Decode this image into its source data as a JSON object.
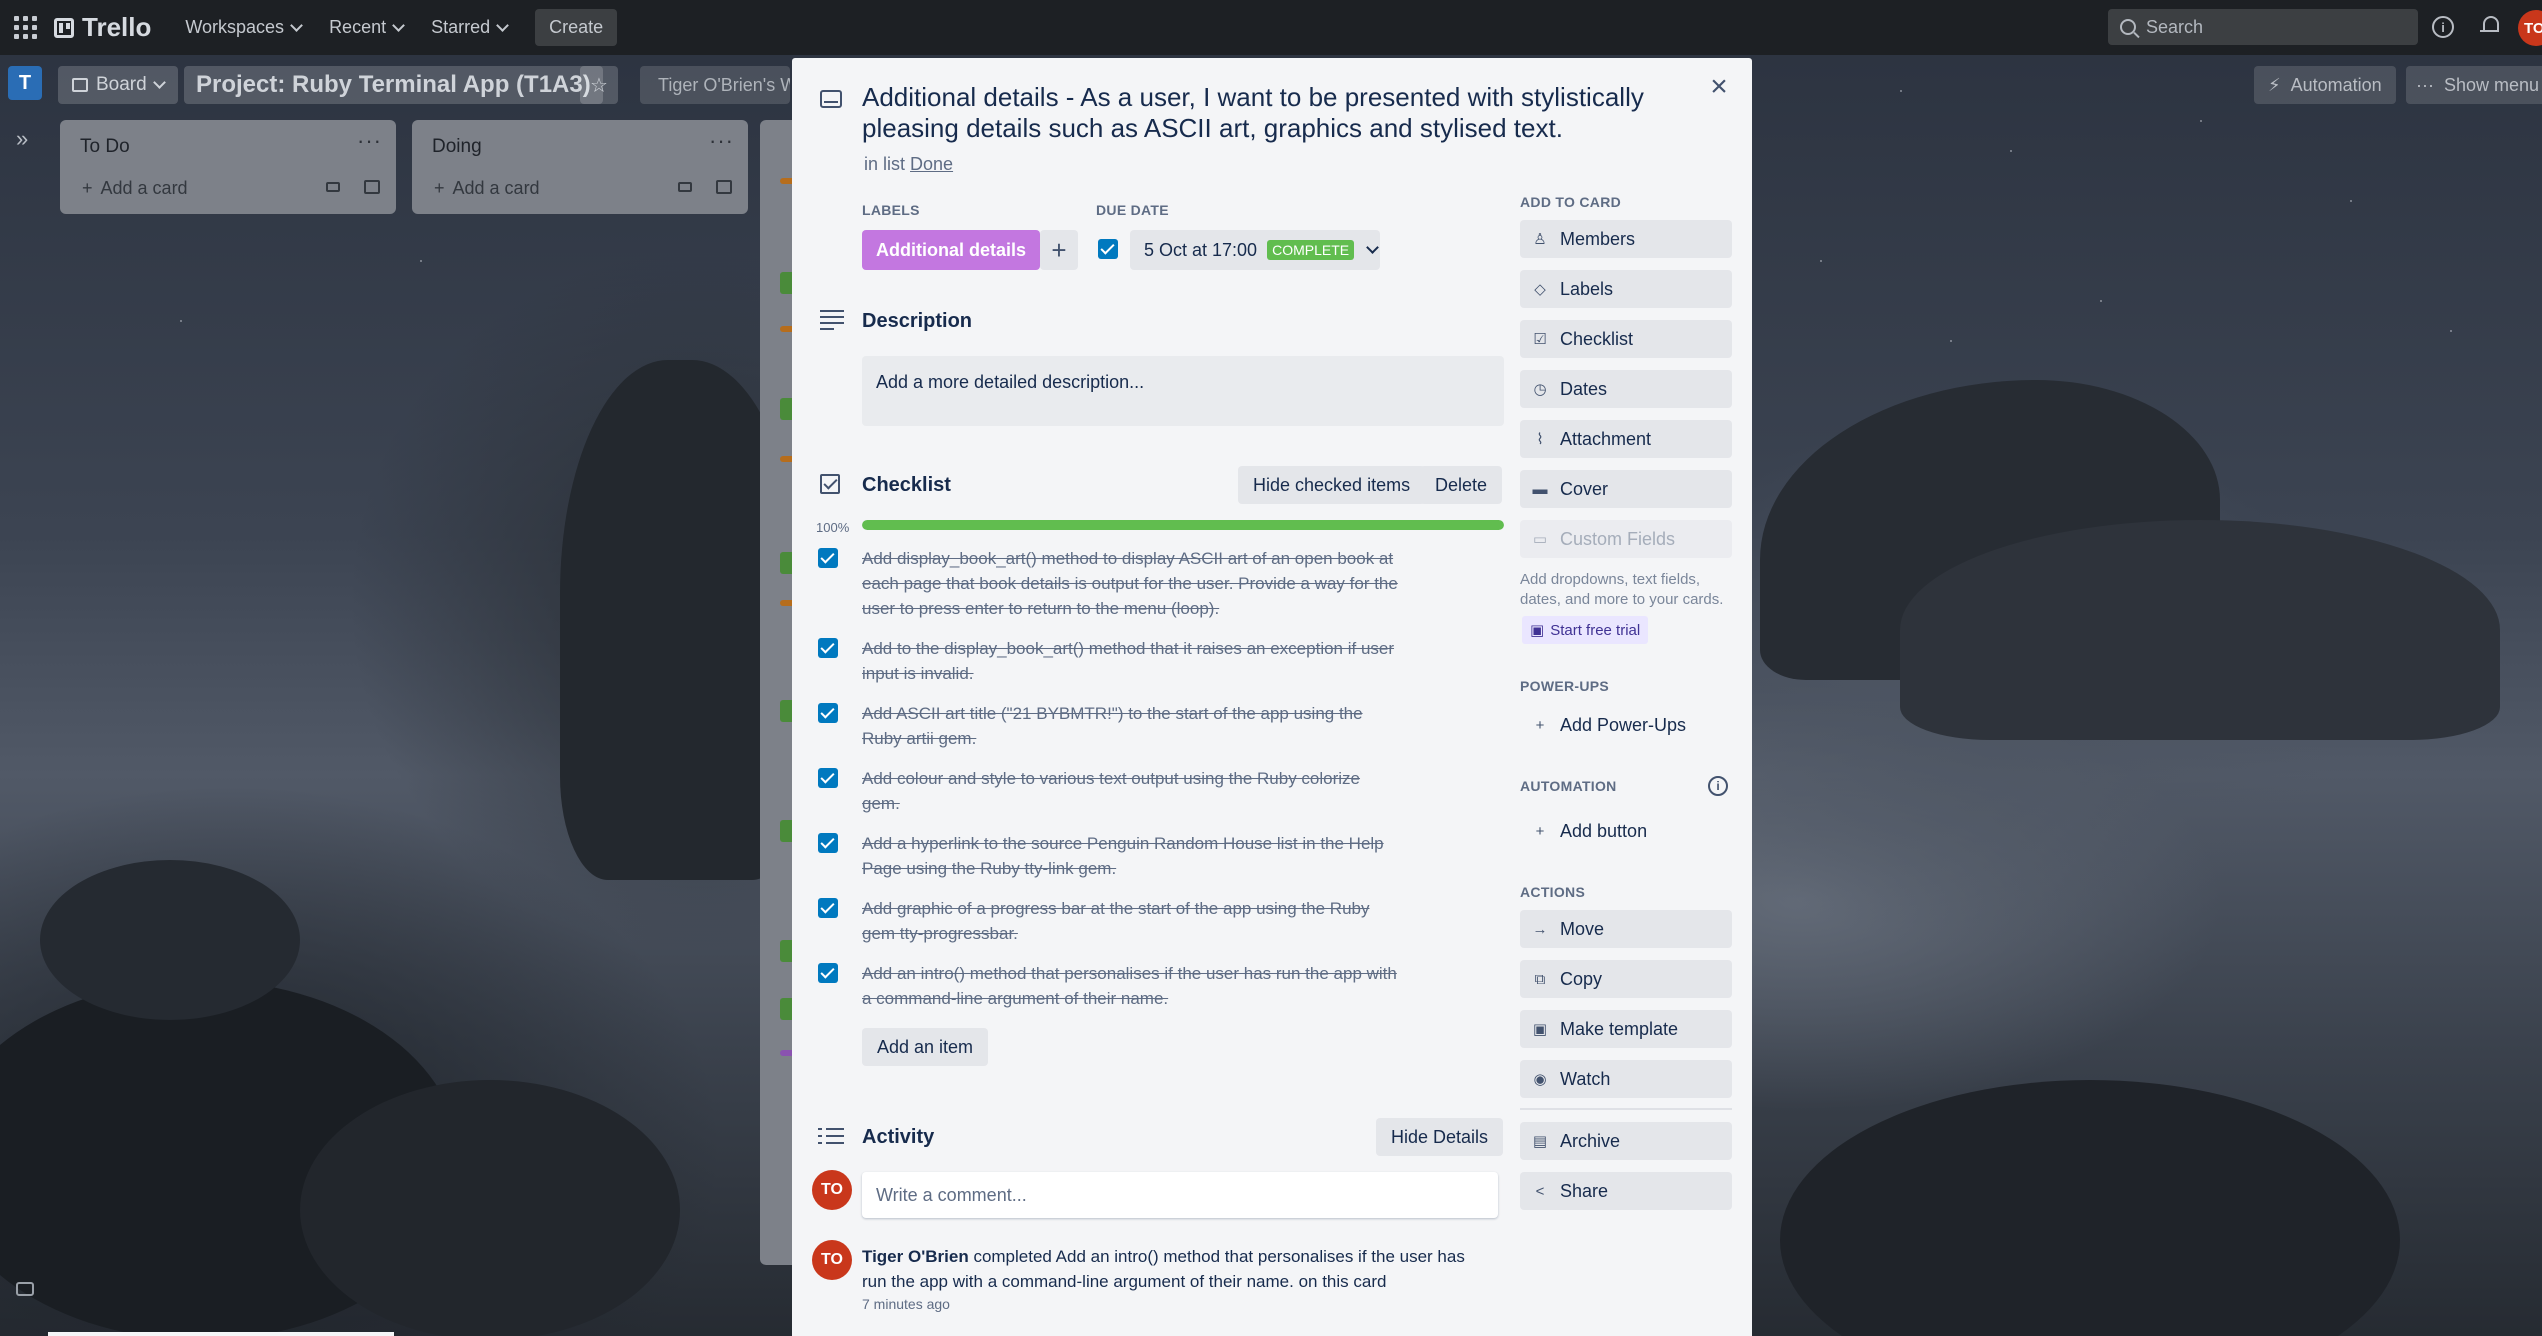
{
  "topbar": {
    "app_name": "Trello",
    "nav": [
      "Workspaces",
      "Recent",
      "Starred"
    ],
    "create_label": "Create",
    "search_placeholder": "Search",
    "user_initials": "TO"
  },
  "board": {
    "letter": "T",
    "view_label": "Board",
    "title": "Project: Ruby Terminal App (T1A3)",
    "workspace_label": "Tiger O'Brien's W",
    "automation_label": "Automation",
    "show_menu_label": "Show menu"
  },
  "lists": [
    {
      "title": "To Do",
      "add_card": "Add a card"
    },
    {
      "title": "Doing",
      "add_card": "Add a card"
    }
  ],
  "card": {
    "title": "Additional details - As a user, I want to be presented with stylistically pleasing details such as ASCII art, graphics and stylised text.",
    "in_list_prefix": "in list",
    "list_name": "Done",
    "labels_heading": "LABELS",
    "label": "Additional details",
    "label_color": "#c377e0",
    "due_heading": "DUE DATE",
    "due_date": "5 Oct at 17:00",
    "due_status": "COMPLETE",
    "description_title": "Description",
    "description_placeholder": "Add a more detailed description...",
    "checklist": {
      "title": "Checklist",
      "hide_checked_label": "Hide checked items",
      "delete_label": "Delete",
      "progress": 1.0,
      "progress_label": "100%",
      "items": [
        "Add display_book_art() method to display ASCII art of an open book at each page that book details is output for the user. Provide a way for the user to press enter to return to the menu (loop).",
        "Add to the display_book_art() method that it raises an exception if user input is invalid.",
        "Add ASCII art title (\"21 BYBMTR!\") to the start of the app using the Ruby artii gem.",
        "Add colour and style to various text output using the Ruby colorize gem.",
        "Add a hyperlink to the source Penguin Random House list in the Help Page using the Ruby tty-link gem.",
        "Add graphic of a progress bar at the start of the app using the Ruby gem tty-progressbar.",
        "Add an intro() method that personalises if the user has run the app with a command-line argument of their name."
      ],
      "add_item_label": "Add an item"
    },
    "activity": {
      "title": "Activity",
      "hide_details_label": "Hide Details",
      "comment_placeholder": "Write a comment...",
      "avatar_initials": "TO",
      "entry_user": "Tiger O'Brien",
      "entry_text": "completed Add an intro() method that personalises if the user has run the app with a command-line argument of their name. on this card",
      "entry_time": "7 minutes ago"
    }
  },
  "sidebar": {
    "add_to_card_heading": "ADD TO CARD",
    "add_to_card": [
      {
        "label": "Members",
        "icon": "person-icon"
      },
      {
        "label": "Labels",
        "icon": "tag-icon"
      },
      {
        "label": "Checklist",
        "icon": "checklist-icon"
      },
      {
        "label": "Dates",
        "icon": "clock-icon"
      },
      {
        "label": "Attachment",
        "icon": "paperclip-icon"
      },
      {
        "label": "Cover",
        "icon": "cover-icon"
      },
      {
        "label": "Custom Fields",
        "icon": "custom-fields-icon"
      }
    ],
    "custom_fields_note": "Add dropdowns, text fields, dates, and more to your cards.",
    "trial_label": "Start free trial",
    "powerups_heading": "POWER-UPS",
    "add_powerups_label": "Add Power-Ups",
    "automation_heading": "AUTOMATION",
    "add_button_label": "Add button",
    "actions_heading": "ACTIONS",
    "actions": [
      {
        "label": "Move",
        "icon": "arrow-right-icon"
      },
      {
        "label": "Copy",
        "icon": "copy-icon"
      },
      {
        "label": "Make template",
        "icon": "template-icon"
      },
      {
        "label": "Watch",
        "icon": "eye-icon"
      },
      {
        "label": "Archive",
        "icon": "archive-icon"
      },
      {
        "label": "Share",
        "icon": "share-icon"
      }
    ]
  }
}
